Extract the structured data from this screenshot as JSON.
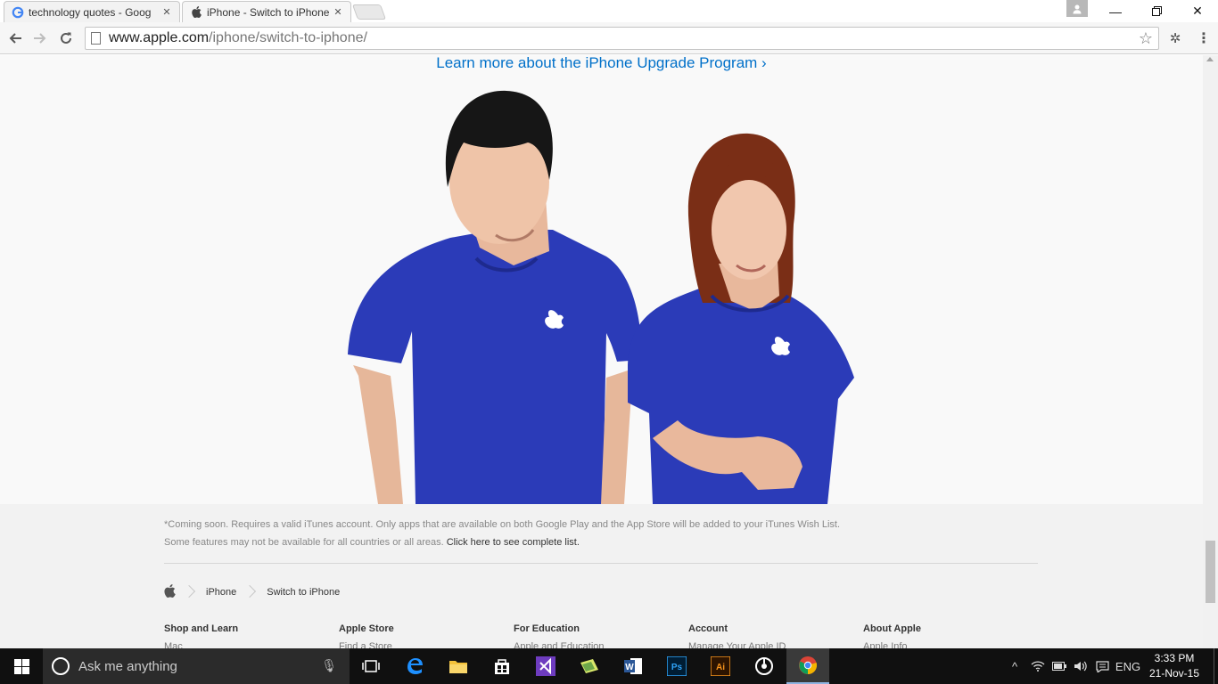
{
  "browser": {
    "tabs": [
      {
        "title": "technology quotes - Goog",
        "favicon": "G",
        "active": false
      },
      {
        "title": "iPhone - Switch to iPhone",
        "favicon": "",
        "active": true
      }
    ],
    "url_host": "www.apple.com",
    "url_path": "/iphone/switch-to-iphone/"
  },
  "page": {
    "upgrade_link": "Learn more about the iPhone Upgrade Program ›",
    "footnote_line1": "*Coming soon. Requires a valid iTunes account. Only apps that are available on both Google Play and the App Store will be added to your iTunes Wish List.",
    "footnote_line2_prefix": "Some features may not be available for all countries or all areas.",
    "footnote_link": "Click here to see complete list.",
    "breadcrumb": [
      "iPhone",
      "Switch to iPhone"
    ],
    "footer_columns": [
      {
        "title": "Shop and Learn",
        "first_item": "Mac"
      },
      {
        "title": "Apple Store",
        "first_item": "Find a Store"
      },
      {
        "title": "For Education",
        "first_item": "Apple and Education"
      },
      {
        "title": "Account",
        "first_item": "Manage Your Apple ID"
      },
      {
        "title": "About Apple",
        "first_item": "Apple Info"
      }
    ]
  },
  "taskbar": {
    "search_placeholder": "Ask me anything",
    "language": "ENG",
    "time": "3:33 PM",
    "date": "21-Nov-15"
  },
  "colors": {
    "link": "#0070c9",
    "shirt": "#2b3bb8",
    "taskbar": "#101010"
  }
}
